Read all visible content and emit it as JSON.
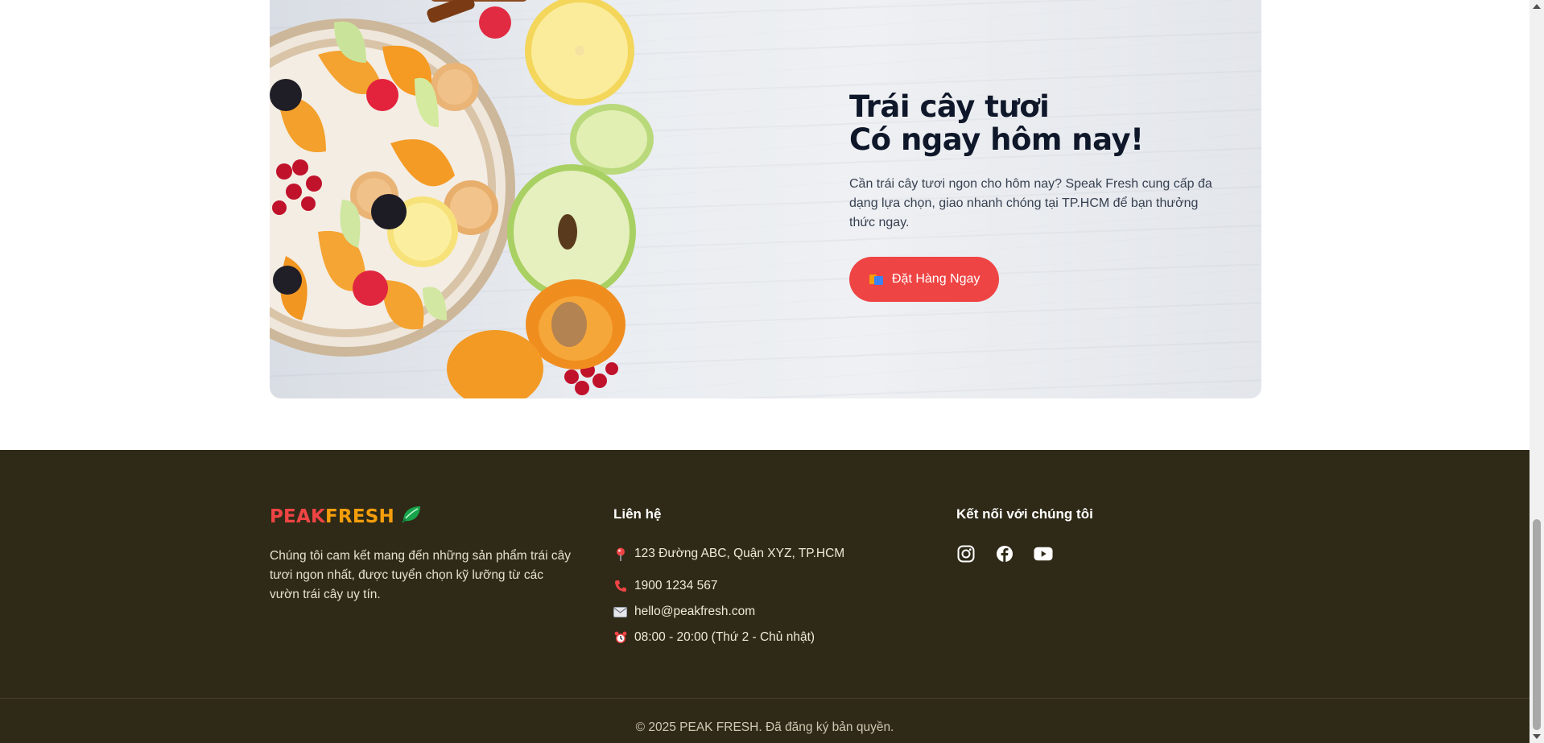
{
  "promo": {
    "title_line1": "Trái cây tươi",
    "title_line2": "Có ngay hôm nay!",
    "description": "Cần trái cây tươi ngon cho hôm nay? Speak Fresh cung cấp đa dạng lựa chọn, giao nhanh chóng tại TP.HCM để bạn thưởng thức ngay.",
    "cta_label": "Đặt Hàng Ngay",
    "cta_icon": "shopping-cart-icon"
  },
  "footer": {
    "brand_part1": "PEAK",
    "brand_part2": "FRESH",
    "brand_icon": "leaf-icon",
    "about": "Chúng tôi cam kết mang đến những sản phẩm trái cây tươi ngon nhất, được tuyển chọn kỹ lưỡng từ các vườn trái cây uy tín.",
    "contact_title": "Liên hệ",
    "contacts": [
      {
        "icon": "map-pin-icon",
        "text": "123 Đường ABC, Quận XYZ, TP.HCM"
      },
      {
        "icon": "phone-icon",
        "text": "1900 1234 567"
      },
      {
        "icon": "email-icon",
        "text": "hello@peakfresh.com"
      },
      {
        "icon": "alarm-clock-icon",
        "text": "08:00 - 20:00 (Thứ 2 - Chủ nhật)"
      }
    ],
    "social_title": "Kết nối với chúng tôi",
    "socials": [
      "instagram-icon",
      "facebook-icon",
      "youtube-icon"
    ],
    "copyright": "© 2025 PEAK FRESH. Đã đăng ký bản quyền."
  },
  "colors": {
    "accent_red": "#ef4444",
    "brand_orange": "#f59e0b",
    "footer_bg": "#2f2a17",
    "heading_dark": "#0f172a"
  }
}
